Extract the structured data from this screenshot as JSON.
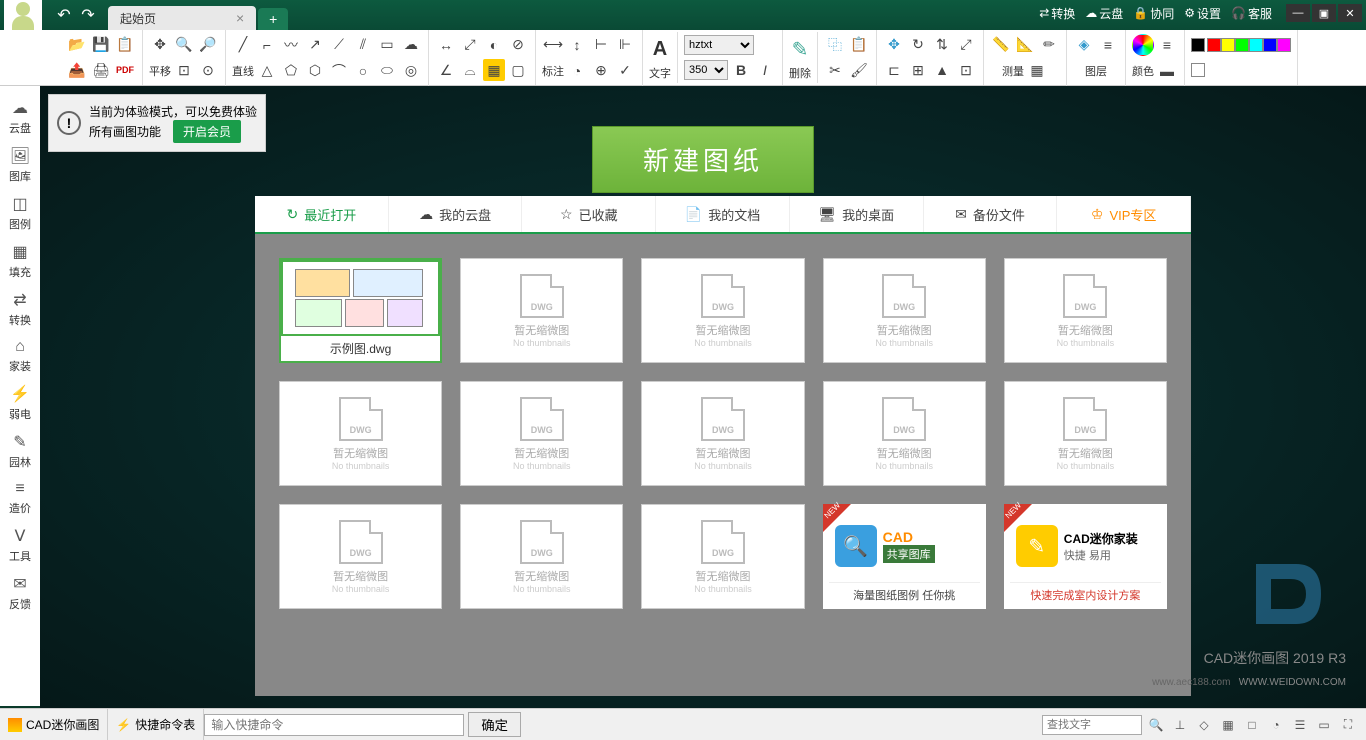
{
  "titlebar": {
    "tab_name": "起始页",
    "links": {
      "convert": "转换",
      "cloud": "云盘",
      "collab": "协同",
      "settings": "设置",
      "service": "客服"
    }
  },
  "toolbar": {
    "groups": {
      "pan": "平移",
      "line": "直线",
      "annotate": "标注",
      "text": "文字",
      "delete": "删除",
      "measure": "测量",
      "layer": "图层",
      "color": "颜色"
    },
    "font_name": "hztxt",
    "font_size": "350"
  },
  "sidebar": {
    "items": [
      {
        "icon": "☁",
        "label": "云盘"
      },
      {
        "icon": "🖼",
        "label": "图库"
      },
      {
        "icon": "◫",
        "label": "图例"
      },
      {
        "icon": "▦",
        "label": "填充"
      },
      {
        "icon": "⇄",
        "label": "转换"
      },
      {
        "icon": "⌂",
        "label": "家装"
      },
      {
        "icon": "⚡",
        "label": "弱电"
      },
      {
        "icon": "✎",
        "label": "园林"
      },
      {
        "icon": "≡",
        "label": "造价"
      },
      {
        "icon": "Ⅴ",
        "label": "工具"
      },
      {
        "icon": "✉",
        "label": "反馈"
      }
    ]
  },
  "notice": {
    "line1": "当前为体验模式，可以免费体验",
    "line2": "所有画图功能",
    "button": "开启会员"
  },
  "main": {
    "new_button": "新建图纸",
    "tabs": [
      {
        "icon": "↻",
        "label": "最近打开",
        "active": true
      },
      {
        "icon": "☁",
        "label": "我的云盘"
      },
      {
        "icon": "☆",
        "label": "已收藏"
      },
      {
        "icon": "📄",
        "label": "我的文档"
      },
      {
        "icon": "🖥",
        "label": "我的桌面"
      },
      {
        "icon": "✉",
        "label": "备份文件"
      },
      {
        "icon": "♔",
        "label": "VIP专区",
        "vip": true
      }
    ],
    "file1_name": "示例图.dwg",
    "no_thumb": "暂无缩微图",
    "no_thumb_sub": "No thumbnails",
    "dwg_label": "DWG",
    "promo1": {
      "new": "NEW",
      "title": "CAD",
      "subtitle": "共享图库",
      "bottom": "海量图纸图例 任你挑"
    },
    "promo2": {
      "new": "NEW",
      "title": "CAD迷你家装",
      "subtitle": "快捷 易用",
      "bottom": "快速完成室内设计方案"
    }
  },
  "watermark": {
    "product": "CAD迷你画图 2019 R3",
    "url": "www.aec188.com",
    "url2": "WWW.WEIDOWN.COM"
  },
  "statusbar": {
    "app_name": "CAD迷你画图",
    "cmd_label": "快捷命令表",
    "cmd_placeholder": "输入快捷命令",
    "confirm": "确定",
    "search_placeholder": "查找文字"
  },
  "colors": [
    "#ff0000",
    "#ffff00",
    "#00ff00",
    "#00ffff",
    "#0000ff",
    "#ff00ff"
  ]
}
